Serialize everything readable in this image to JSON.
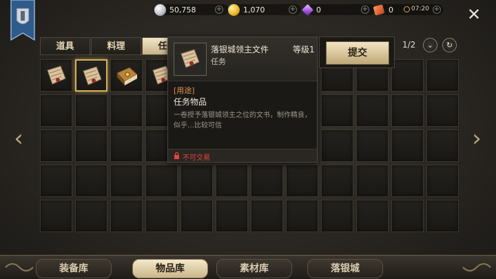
{
  "currencies": {
    "silver": "50,758",
    "gold": "1,070",
    "gem": "0",
    "ticket": "0",
    "time": "07:20",
    "plus_label": "+"
  },
  "close_label": "✕",
  "tabs": [
    {
      "label": "道具",
      "active": false
    },
    {
      "label": "料理",
      "active": false
    },
    {
      "label": "任务",
      "active": true
    }
  ],
  "pager": {
    "text": "1/2"
  },
  "grid": {
    "rows": 5,
    "cols": 12,
    "items": [
      {
        "slot": 0,
        "icon": "scroll-icon"
      },
      {
        "slot": 1,
        "icon": "scroll-icon",
        "selected": true
      },
      {
        "slot": 2,
        "icon": "book-icon"
      },
      {
        "slot": 3,
        "icon": "scroll-icon"
      }
    ]
  },
  "tooltip": {
    "name": "落银城领主文件",
    "level": "等级1",
    "type": "任务",
    "usage_header": "[用途]",
    "usage": "任务物品",
    "description": "一卷授予落银城领主之位的文书，制作精良，似乎…比较可信",
    "trade": "不可交易"
  },
  "submit_label": "提交",
  "bottom_nav": [
    {
      "label": "装备库",
      "active": false
    },
    {
      "label": "物品库",
      "active": true
    },
    {
      "label": "素材库",
      "active": false
    },
    {
      "label": "落银城",
      "active": false
    }
  ],
  "colors": {
    "accent_gold": "#d9b25c",
    "warning_red": "#e2463a",
    "usage_orange": "#e0944a"
  }
}
